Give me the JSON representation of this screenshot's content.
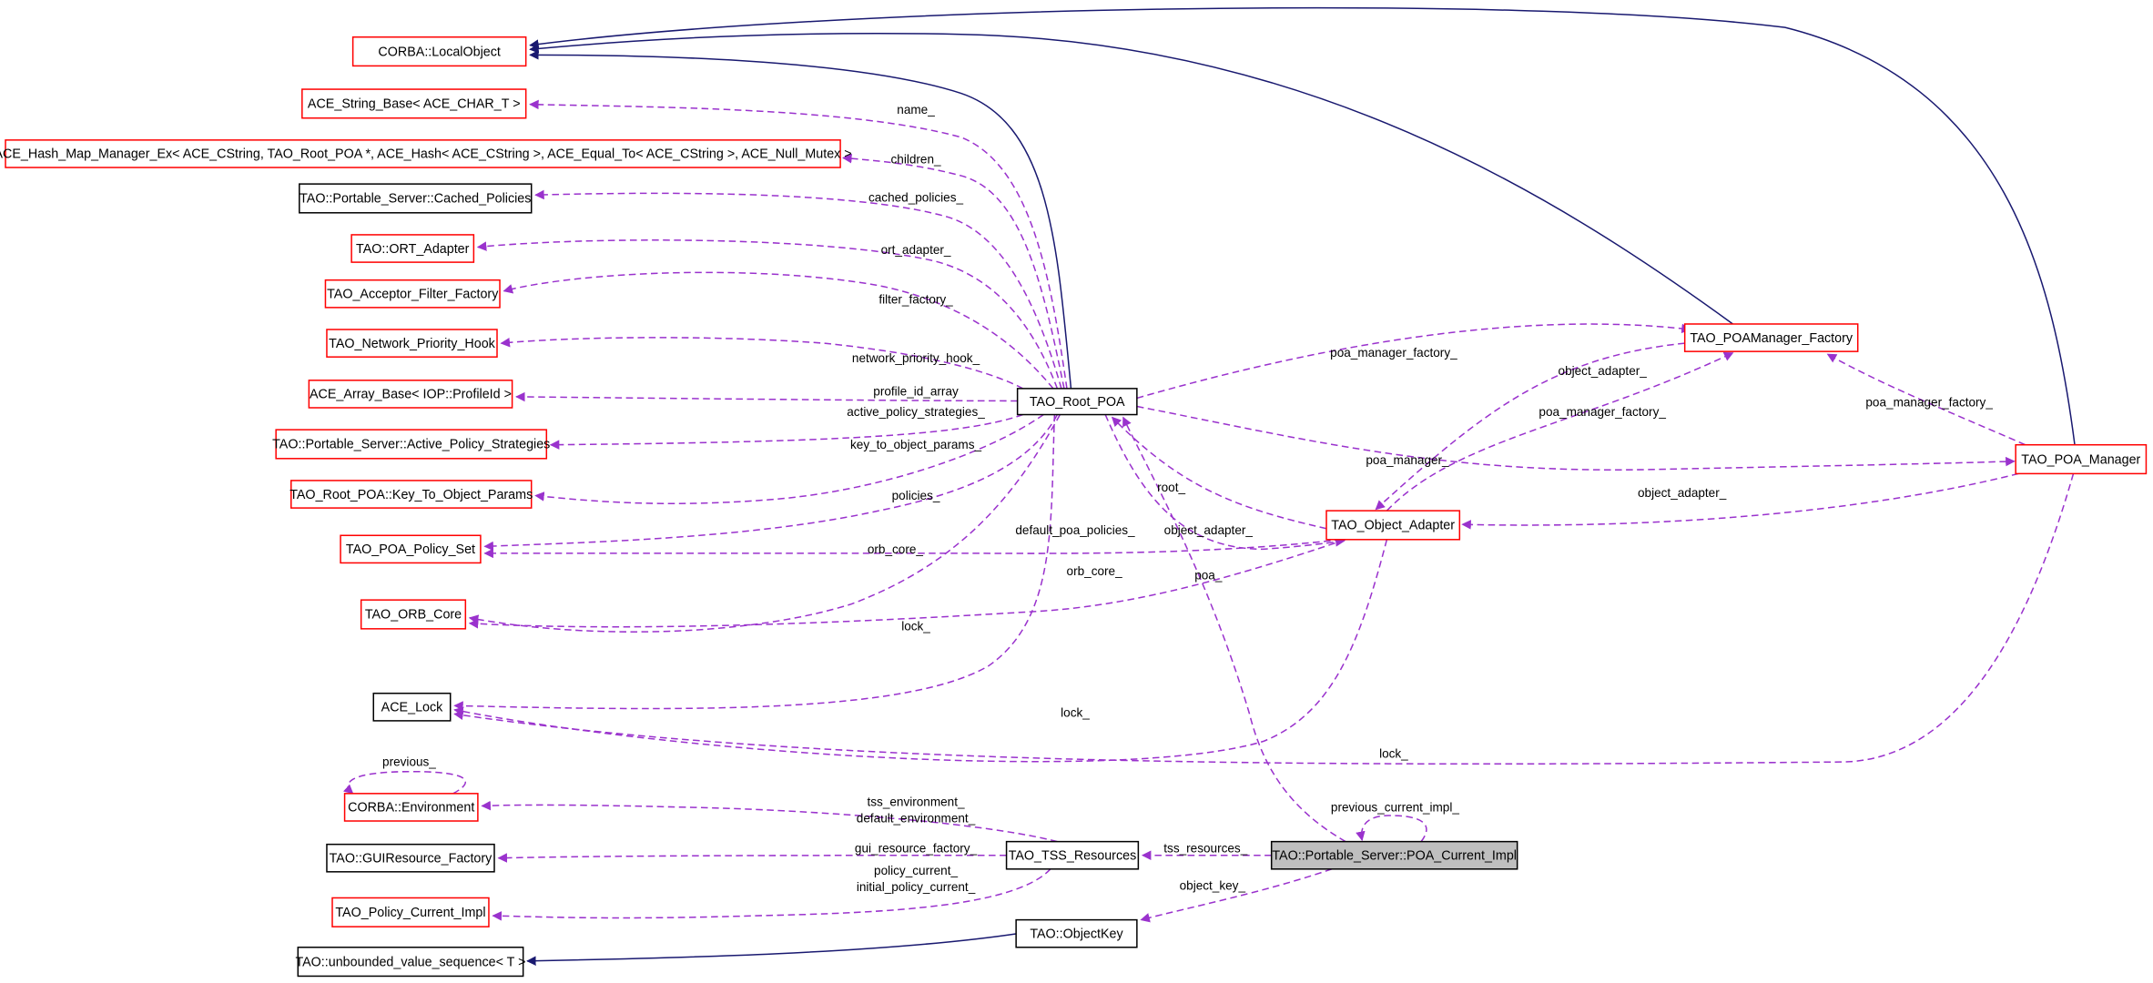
{
  "colors": {
    "inheritance_edge": "#191970",
    "usage_edge": "#9a32cd",
    "red_border": "#ff0000",
    "black_border": "#000000",
    "focus_fill": "#bfbfbf"
  },
  "nodes": [
    {
      "label": "CORBA::LocalObject",
      "border": "red"
    },
    {
      "label": "ACE_String_Base< ACE_CHAR_T >",
      "border": "red"
    },
    {
      "label": "ACE_Hash_Map_Manager_Ex< ACE_CString, TAO_Root_POA *, ACE_Hash< ACE_CString >, ACE_Equal_To< ACE_CString >, ACE_Null_Mutex >",
      "border": "red"
    },
    {
      "label": "TAO::Portable_Server::Cached_Policies",
      "border": "black"
    },
    {
      "label": "TAO::ORT_Adapter",
      "border": "red"
    },
    {
      "label": "TAO_Acceptor_Filter_Factory",
      "border": "red"
    },
    {
      "label": "TAO_Network_Priority_Hook",
      "border": "red"
    },
    {
      "label": "ACE_Array_Base< IOP::ProfileId >",
      "border": "red"
    },
    {
      "label": "TAO::Portable_Server::Active_Policy_Strategies",
      "border": "red"
    },
    {
      "label": "TAO_Root_POA::Key_To_Object_Params",
      "border": "red"
    },
    {
      "label": "TAO_POA_Policy_Set",
      "border": "red"
    },
    {
      "label": "TAO_ORB_Core",
      "border": "red"
    },
    {
      "label": "ACE_Lock",
      "border": "black"
    },
    {
      "label": "CORBA::Environment",
      "border": "red"
    },
    {
      "label": "TAO::GUIResource_Factory",
      "border": "black"
    },
    {
      "label": "TAO_Policy_Current_Impl",
      "border": "red"
    },
    {
      "label": "TAO::unbounded_value_sequence< T >",
      "border": "black"
    },
    {
      "label": "TAO_Root_POA",
      "border": "black"
    },
    {
      "label": "TAO_POAManager_Factory",
      "border": "red"
    },
    {
      "label": "TAO_POA_Manager",
      "border": "red"
    },
    {
      "label": "TAO_Object_Adapter",
      "border": "red"
    },
    {
      "label": "TAO_TSS_Resources",
      "border": "black"
    },
    {
      "label": "TAO::Portable_Server::POA_Current_Impl",
      "border": "black",
      "focus": true
    },
    {
      "label": "TAO::ObjectKey",
      "border": "black"
    }
  ],
  "edge_labels": {
    "name": "name_",
    "children": "children_",
    "cached_policies": "cached_policies_",
    "ort_adapter": "ort_adapter_",
    "filter_factory": "filter_factory_",
    "network_priority_hook": "network_priority_hook_",
    "profile_id_array": "profile_id_array",
    "active_policy_strategies": "active_policy_strategies_",
    "key_to_object_params": "key_to_object_params_",
    "policies": "policies_",
    "default_poa_policies": "default_poa_policies_",
    "orb_core_root": "orb_core_",
    "orb_core_oa": "orb_core_",
    "lock_root": "lock_",
    "lock_oa": "lock_",
    "lock_pm": "lock_",
    "poa_manager_factory_root": "poa_manager_factory_",
    "object_adapter_factory": "object_adapter_",
    "poa_manager_factory_oa": "poa_manager_factory_",
    "poa_manager_factory_pm": "poa_manager_factory_",
    "poa_manager": "poa_manager_",
    "object_adapter_pm": "object_adapter_",
    "root": "root_",
    "object_adapter_root": "object_adapter_",
    "poa": "poa_",
    "previous_current_impl": "previous_current_impl_",
    "tss_resources": "tss_resources_",
    "object_key": "object_key_",
    "tss_environment": "tss_environment_",
    "default_environment": "default_environment_",
    "gui_resource_factory": "gui_resource_factory_",
    "policy_current": "policy_current_",
    "initial_policy_current": "initial_policy_current_",
    "previous": "previous_"
  }
}
